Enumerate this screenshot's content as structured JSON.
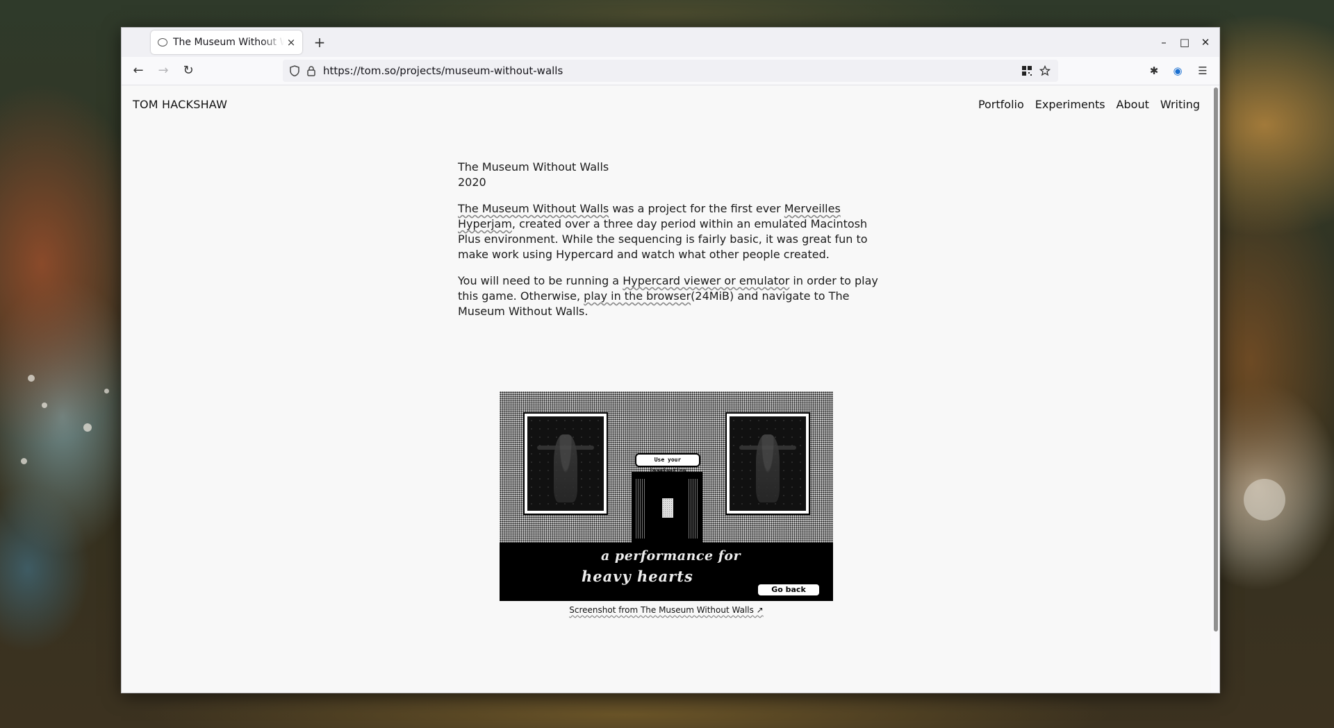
{
  "browser": {
    "tab_title": "The Museum Without Walls",
    "tab_close": "×",
    "new_tab": "+",
    "url": "https://tom.so/projects/museum-without-walls",
    "window_controls": [
      "–",
      "□",
      "✕"
    ],
    "nav": {
      "back": "←",
      "forward": "→",
      "reload": "↻"
    },
    "icons": [
      "shield-icon",
      "lock-icon",
      "qr-code-icon",
      "bookmark-star-icon",
      "extension-icon",
      "account-icon",
      "menu-icon"
    ]
  },
  "site": {
    "name": "TOM HACKSHAW",
    "nav": [
      "Portfolio",
      "Experiments",
      "About",
      "Writing"
    ]
  },
  "article": {
    "title": "The Museum Without Walls",
    "year": "2020",
    "p1": {
      "link1": "The Museum Without Walls",
      "text1": " was a project for the first ever ",
      "link2": "Merveilles Hyperjam",
      "text2": ", created over a three day period within an emulated Macintosh Plus environment. While the sequencing is fairly basic, it was great fun to make work using Hypercard and watch what other people created."
    },
    "p2": {
      "text1": "You will need to be running a ",
      "link1": "Hypercard viewer or emulator",
      "text2": " in order to play this game. Otherwise, ",
      "link2": "play in the browser",
      "text3": "(24MiB) and navigate to The Museum Without Walls."
    }
  },
  "figure": {
    "imagine_label": "Use your imagination",
    "perf_line1": "a performance for",
    "perf_line2": "heavy hearts",
    "go_back": "Go back",
    "caption": "Screenshot from The Museum Without Walls ↗"
  }
}
